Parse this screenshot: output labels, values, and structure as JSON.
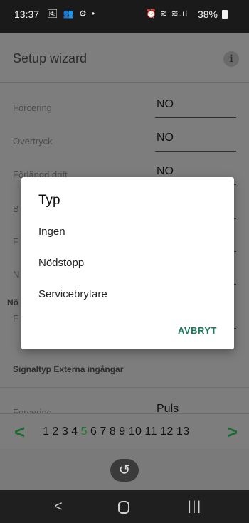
{
  "status_bar": {
    "time": "13:37",
    "left_icons": "🖼 👥 ⚙ •",
    "right_icons": "⏰ ≋ ≋.ıl",
    "battery": "38%"
  },
  "app_bar": {
    "title": "Setup wizard",
    "info_icon": "i"
  },
  "form_rows": [
    {
      "label": "Forcering",
      "value": "NO"
    },
    {
      "label": "Övertryck",
      "value": "NO"
    },
    {
      "label": "Förlängd drift",
      "value": "NO"
    },
    {
      "label": "B",
      "value": ""
    },
    {
      "label": "F",
      "value": ""
    },
    {
      "label": "N",
      "value": ""
    }
  ],
  "section_partial": "Nö",
  "row_after_section": {
    "label": "F",
    "value": ""
  },
  "section_signal": "Signaltyp Externa ingångar",
  "row_bottom": {
    "label": "Forcering",
    "value": "Puls"
  },
  "pager": {
    "prev": "<",
    "next": ">",
    "pages": [
      "1",
      "2",
      "3",
      "4",
      "5",
      "6",
      "7",
      "8",
      "9",
      "10",
      "11",
      "12",
      "13"
    ],
    "current": "5"
  },
  "back_button_icon": "↺",
  "nav_bar": {
    "back": "<",
    "recent": "|||"
  },
  "dialog": {
    "title": "Typ",
    "options": [
      "Ingen",
      "Nödstopp",
      "Servicebrytare"
    ],
    "cancel": "AVBRYT"
  },
  "colors": {
    "accent_green": "#1b7a2f",
    "dialog_accent": "#1a7a5c",
    "scrim_gray": "#7d7d7d"
  }
}
